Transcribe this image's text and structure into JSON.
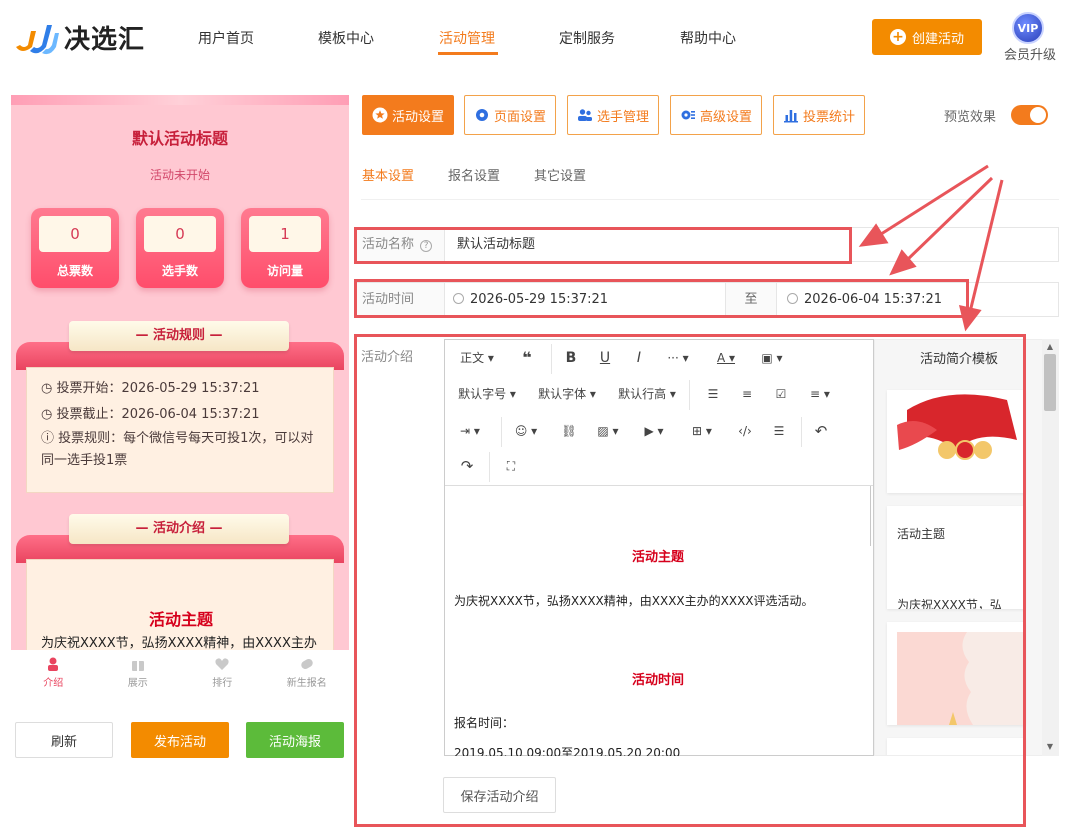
{
  "app": {
    "logo_text": "决选汇",
    "create_label": "创建活动",
    "vip_badge": "VIP",
    "vip_label": "会员升级"
  },
  "nav": {
    "items": [
      {
        "label": "用户首页"
      },
      {
        "label": "模板中心"
      },
      {
        "label": "活动管理"
      },
      {
        "label": "定制服务"
      },
      {
        "label": "帮助中心"
      }
    ],
    "active": "活动管理"
  },
  "preview": {
    "title": "默认活动标题",
    "status": "活动未开始",
    "stats": [
      {
        "value": "0",
        "label": "总票数"
      },
      {
        "value": "0",
        "label": "选手数"
      },
      {
        "value": "1",
        "label": "访问量"
      }
    ],
    "rules_title": "— 活动规则 —",
    "rules": [
      "投票开始：2026-05-29 15:37:21",
      "投票截止：2026-06-04 15:37:21",
      "投票规则：每个微信号每天可投1次，可以对同一选手投1票"
    ],
    "intro_title": "— 活动介绍 —",
    "intro_heading": "活动主题",
    "intro_text": "为庆祝XXXX节，弘扬XXXX精神，由XXXX主办",
    "tabs": [
      {
        "label": "介绍",
        "icon": "user-icon"
      },
      {
        "label": "展示",
        "icon": "gift-icon"
      },
      {
        "label": "排行",
        "icon": "heart-icon"
      },
      {
        "label": "新生报名",
        "icon": "tag-icon"
      }
    ],
    "buttons": {
      "refresh": "刷新",
      "publish": "发布活动",
      "poster": "活动海报"
    }
  },
  "settings": {
    "top_buttons": [
      {
        "label": "活动设置",
        "icon": "star-icon"
      },
      {
        "label": "页面设置",
        "icon": "gear-icon"
      },
      {
        "label": "选手管理",
        "icon": "users-icon"
      },
      {
        "label": "高级设置",
        "icon": "advanced-icon"
      },
      {
        "label": "投票统计",
        "icon": "bar-chart-icon"
      }
    ],
    "preview_label": "预览效果",
    "subtabs": [
      {
        "label": "基本设置"
      },
      {
        "label": "报名设置"
      },
      {
        "label": "其它设置"
      }
    ],
    "name_label": "活动名称",
    "name_value": "默认活动标题",
    "time_label": "活动时间",
    "time_start": "2026-05-29 15:37:21",
    "time_sep": "至",
    "time_end": "2026-06-04 15:37:21",
    "intro_label": "活动介绍",
    "save_intro": "保存活动介绍"
  },
  "editor": {
    "toolbar": {
      "paragraph": "正文",
      "font_size": "默认字号",
      "font_family": "默认字体",
      "line_height": "默认行高"
    },
    "content": {
      "heading1": "活动主题",
      "text1": "为庆祝XXXX节，弘扬XXXX精神，由XXXX主办的XXXX评选活动。",
      "heading2": "活动时间",
      "text2": "报名时间：",
      "text3": "2019.05.10 09:00至2019.05.20 20:00"
    }
  },
  "templates": {
    "title": "活动简介模板",
    "card2_title": "活动主题",
    "card2_text": "为庆祝XXXX节，弘"
  },
  "colors": {
    "accent": "#f37b1d",
    "annotation": "#e8555a",
    "preview_bg": "#ffc8d2"
  }
}
